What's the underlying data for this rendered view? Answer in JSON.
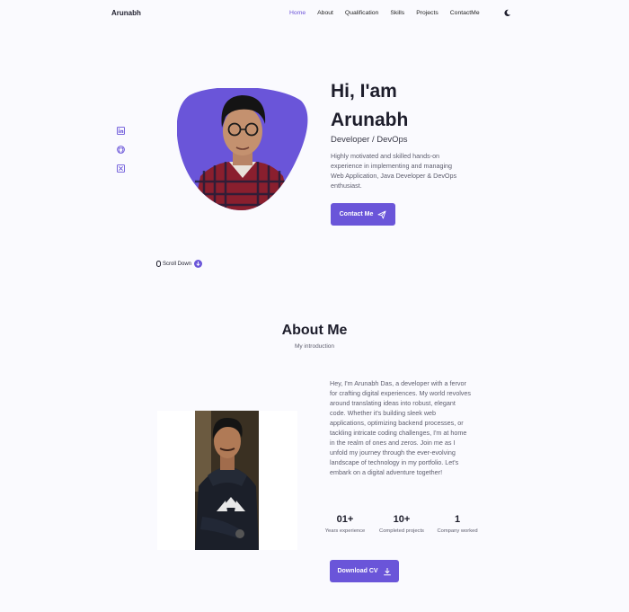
{
  "header": {
    "logo": "Arunabh",
    "nav": [
      "Home",
      "About",
      "Qualification",
      "Skills",
      "Projects",
      "ContactMe"
    ],
    "active": "Home",
    "theme_icon": "moon-icon"
  },
  "socials": [
    "linkedin-icon",
    "github-icon",
    "x-icon"
  ],
  "hero": {
    "title": "Hi, I'am Arunabh",
    "subtitle": "Developer / DevOps",
    "description": "Highly motivated and skilled hands-on experience in implementing and managing Web Application, Java Developer & DevOps enthusiast.",
    "contact_button": "Contact Me",
    "scroll_label": "Scroll Down"
  },
  "about": {
    "title": "About Me",
    "subtitle": "My introduction",
    "description": "Hey, I'm Arunabh Das, a developer with a fervor for crafting digital experiences. My world revolves around translating ideas into robust, elegant code. Whether it's building sleek web applications, optimizing backend processes, or tackling intricate coding challenges, I'm at home in the realm of ones and zeros. Join me as I unfold my journey through the ever-evolving landscape of technology in my portfolio. Let's embark on a digital adventure together!",
    "stats": [
      {
        "value": "01+",
        "label": "Years experience"
      },
      {
        "value": "10+",
        "label": "Completed projects"
      },
      {
        "value": "1",
        "label": "Company worked"
      }
    ],
    "cv_button": "Download CV"
  },
  "colors": {
    "accent": "#6a55d9",
    "background": "#fafafe"
  }
}
